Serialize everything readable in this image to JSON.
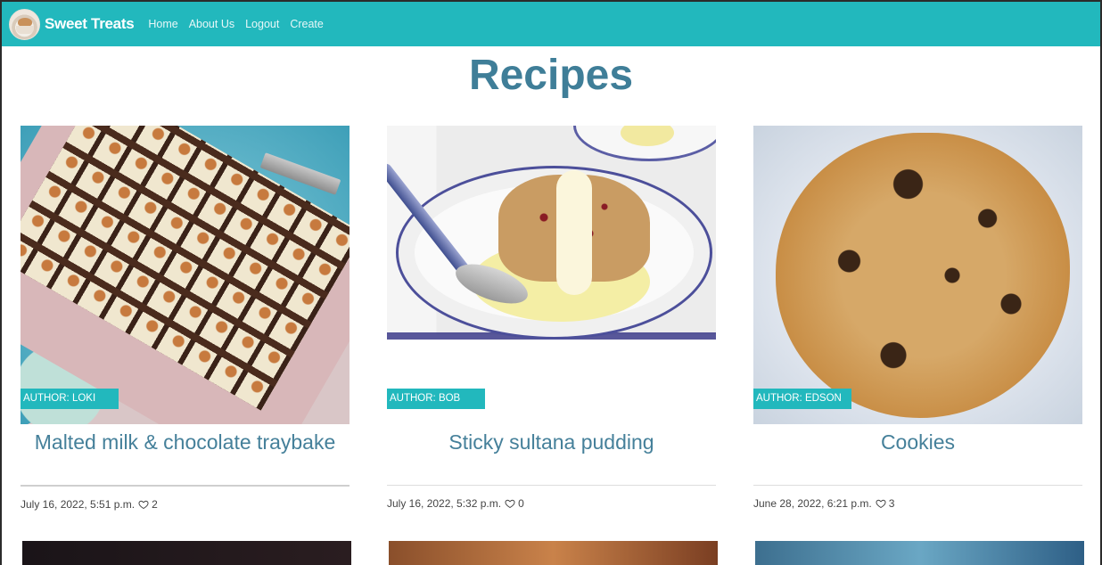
{
  "navbar": {
    "brand": "Sweet Treats",
    "links": [
      "Home",
      "About Us",
      "Logout",
      "Create"
    ]
  },
  "page": {
    "title": "Recipes"
  },
  "recipes": [
    {
      "title": "Malted milk & chocolate traybake",
      "author": "AUTHOR: LOKI",
      "date": "July 16, 2022, 5:51 p.m.",
      "likes": "2"
    },
    {
      "title": "Sticky sultana pudding",
      "author": "AUTHOR: BOB",
      "date": "July 16, 2022, 5:32 p.m.",
      "likes": "0"
    },
    {
      "title": "Cookies",
      "author": "AUTHOR: EDSON",
      "date": "June 28, 2022, 6:21 p.m.",
      "likes": "3"
    }
  ],
  "colors": {
    "navbar": "#22b8bd",
    "title": "#3f7e98",
    "card_title": "#45809a",
    "author_tag": "#22b8bd"
  },
  "icons": {
    "like": "heart-icon"
  }
}
